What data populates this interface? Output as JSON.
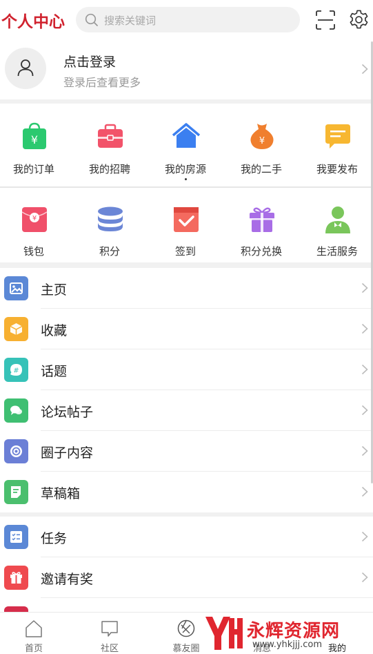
{
  "header": {
    "title": "个人中心",
    "search_placeholder": "搜索关键词",
    "scan_icon": "scan-icon",
    "settings_icon": "gear-icon"
  },
  "profile": {
    "login_title": "点击登录",
    "login_subtitle": "登录后查看更多"
  },
  "grid_row1": [
    {
      "label": "我的订单",
      "icon": "shopping-bag-icon",
      "color": "#2bc96f"
    },
    {
      "label": "我的招聘",
      "icon": "briefcase-icon",
      "color": "#f2536a"
    },
    {
      "label": "我的房源",
      "icon": "house-icon",
      "color": "#3b7ff0"
    },
    {
      "label": "我的二手",
      "icon": "money-bag-icon",
      "color": "#f07f2e"
    },
    {
      "label": "我要发布",
      "icon": "message-icon",
      "color": "#f7b731"
    }
  ],
  "grid_row2": [
    {
      "label": "钱包",
      "icon": "red-packet-icon",
      "color": "#f0506a"
    },
    {
      "label": "积分",
      "icon": "coin-stack-icon",
      "color": "#6b86d6"
    },
    {
      "label": "签到",
      "icon": "check-in-icon",
      "color": "#f46a5f"
    },
    {
      "label": "积分兑换",
      "icon": "gift-icon",
      "color": "#a86de6"
    },
    {
      "label": "生活服务",
      "icon": "service-person-icon",
      "color": "#7ac65b"
    }
  ],
  "menu_group1": [
    {
      "label": "主页",
      "icon": "image-icon",
      "color": "#5b88d6"
    },
    {
      "label": "收藏",
      "icon": "box-icon",
      "color": "#f7b031"
    },
    {
      "label": "话题",
      "icon": "hashtag-icon",
      "color": "#36c2b8"
    },
    {
      "label": "论坛帖子",
      "icon": "chat-icon",
      "color": "#3fbf72"
    },
    {
      "label": "圈子内容",
      "icon": "circle-icon",
      "color": "#6b7fd6"
    },
    {
      "label": "草稿箱",
      "icon": "draft-icon",
      "color": "#4bbf6e"
    }
  ],
  "menu_group2": [
    {
      "label": "任务",
      "icon": "task-list-icon",
      "color": "#5b88d6"
    },
    {
      "label": "邀请有奖",
      "icon": "gift-icon",
      "color": "#ef4a4f"
    }
  ],
  "tabbar": [
    {
      "label": "首页",
      "icon": "home-icon"
    },
    {
      "label": "社区",
      "icon": "community-icon"
    },
    {
      "label": "慕友圈",
      "icon": "friends-circle-icon"
    },
    {
      "label": "消息",
      "icon": "message-icon"
    },
    {
      "label": "我的",
      "icon": "user-icon"
    }
  ],
  "watermark": {
    "text": "永辉资源网",
    "url": "www.yhkjjj.com"
  }
}
